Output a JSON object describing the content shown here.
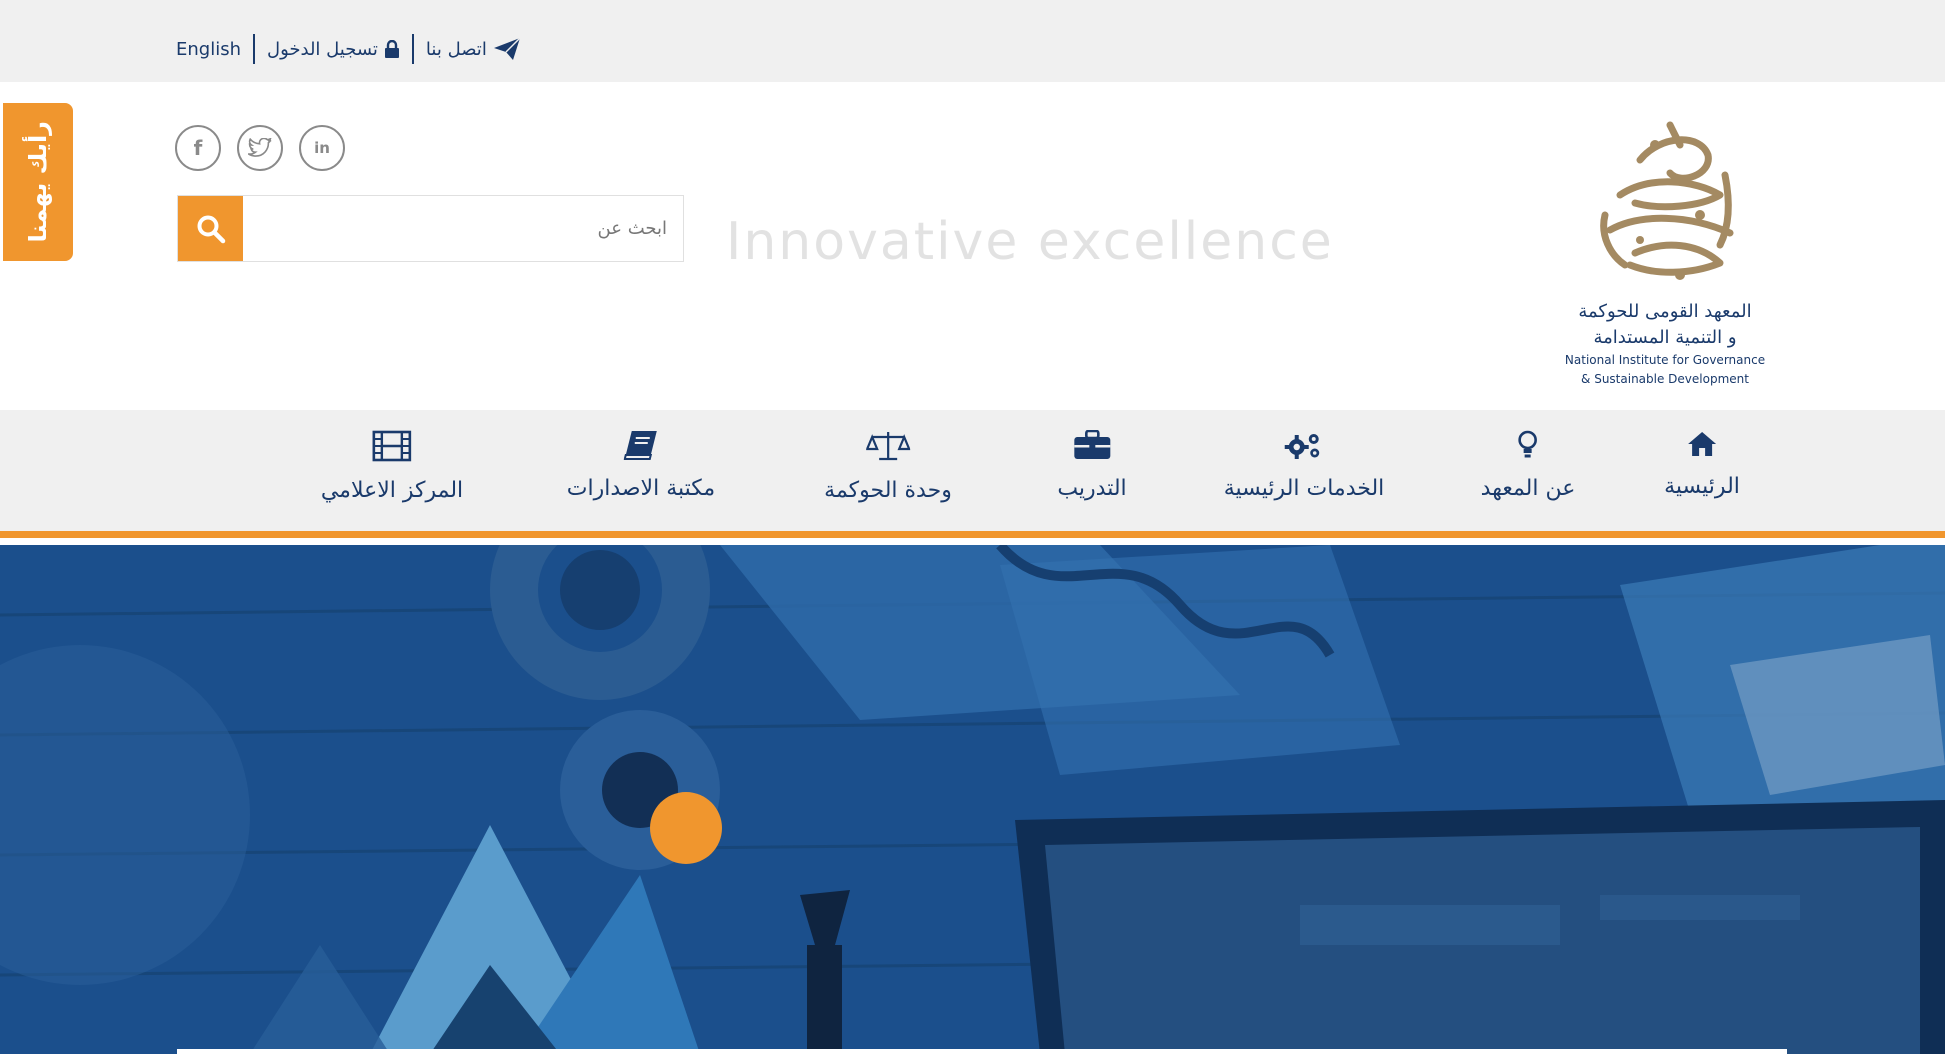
{
  "topbar": {
    "language": "English",
    "login": "تسجيل الدخول",
    "contact": "اتصل بنا"
  },
  "feedback_tab": "رأيك يهمنا",
  "search": {
    "placeholder": "ابحث عن"
  },
  "tagline": "Innovative excellence",
  "logo": {
    "ar_line1": "المعهد القومى للحوكمة",
    "ar_line2": "و التنمية المستدامة",
    "en_line1": "National Institute for Governance",
    "en_line2": "& Sustainable Development"
  },
  "nav": [
    {
      "label": "الرئيسية",
      "icon": "home-icon"
    },
    {
      "label": "عن المعهد",
      "icon": "lightbulb-icon"
    },
    {
      "label": "الخدمات الرئيسية",
      "icon": "cogs-icon"
    },
    {
      "label": "التدريب",
      "icon": "briefcase-icon"
    },
    {
      "label": "وحدة الحوكمة",
      "icon": "scale-icon"
    },
    {
      "label": "مكتبة الاصدارات",
      "icon": "book-icon"
    },
    {
      "label": "المركز الاعلامي",
      "icon": "film-icon"
    }
  ],
  "colors": {
    "accent": "#f0962e",
    "navy": "#1a3a6b",
    "hero_blue": "#1b4f8c",
    "bar_bg": "#f0f0f0"
  }
}
